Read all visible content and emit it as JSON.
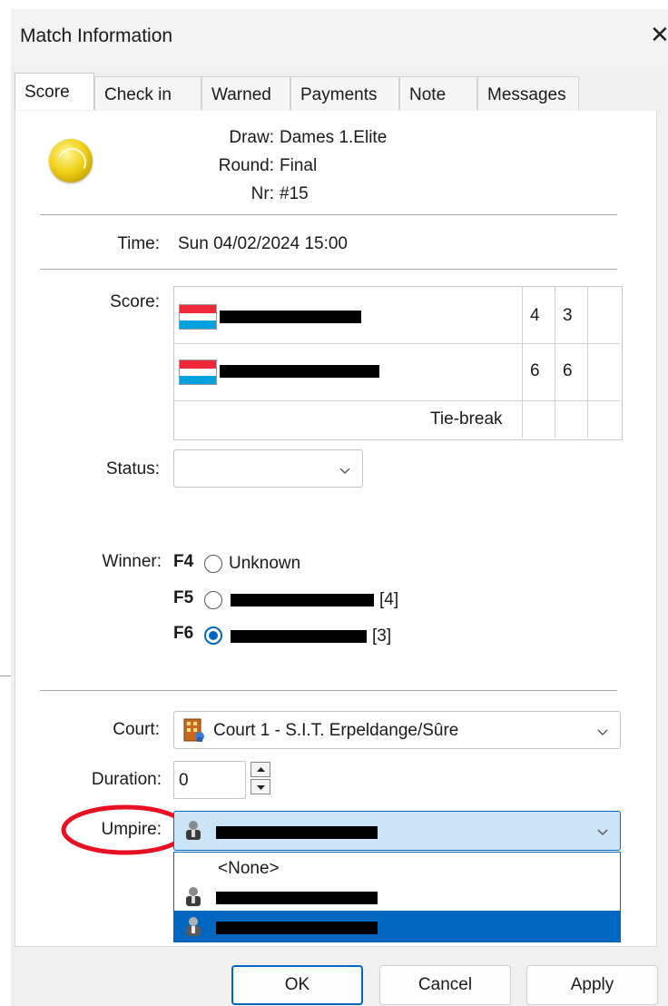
{
  "window": {
    "title": "Match Information",
    "close_glyph": "✕"
  },
  "tabs": [
    {
      "label": "Score",
      "active": true
    },
    {
      "label": "Check in"
    },
    {
      "label": "Warned"
    },
    {
      "label": "Payments"
    },
    {
      "label": "Note"
    },
    {
      "label": "Messages"
    }
  ],
  "match": {
    "icon": "tennis-ball-icon",
    "draw_label": "Draw:",
    "draw_value": "Dames 1.Elite",
    "round_label": "Round:",
    "round_value": "Final",
    "nr_label": "Nr:",
    "nr_value": "#15",
    "time_label": "Time:",
    "time_value": "Sun 04/02/2024 15:00"
  },
  "score": {
    "label": "Score:",
    "rows": [
      {
        "flag": "luxembourg-flag",
        "player": "[redacted]",
        "sets": [
          "4",
          "3",
          ""
        ]
      },
      {
        "flag": "luxembourg-flag",
        "player": "[redacted]",
        "sets": [
          "6",
          "6",
          ""
        ]
      }
    ],
    "tiebreak_label": "Tie-break"
  },
  "status": {
    "label": "Status:",
    "value": ""
  },
  "winner": {
    "label": "Winner:",
    "options": [
      {
        "key": "F4",
        "text": "Unknown",
        "selected": false
      },
      {
        "key": "F5",
        "text": "[4]",
        "selected": false
      },
      {
        "key": "F6",
        "text": "[3]",
        "selected": true
      }
    ]
  },
  "court": {
    "label": "Court:",
    "value": "Court 1 - S.I.T. Erpeldange/Sûre"
  },
  "duration": {
    "label": "Duration:",
    "value": "0"
  },
  "umpire": {
    "label": "Umpire:",
    "dropdown_options": [
      "<None>",
      "[redacted]",
      "[redacted]"
    ],
    "highlight_color": "#e81123"
  },
  "buttons": {
    "ok": "OK",
    "cancel": "Cancel",
    "apply": "Apply"
  },
  "colors": {
    "accent": "#0067c0",
    "selection": "#0067c0"
  }
}
